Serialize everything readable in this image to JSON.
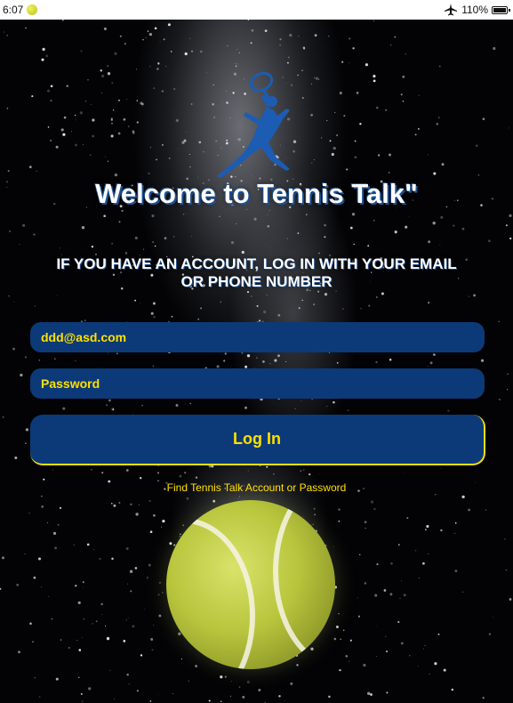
{
  "status_bar": {
    "time": "6:07",
    "battery": "110%"
  },
  "icons": {
    "status_app": "tennis-ball-icon",
    "airplane": "airplane-icon",
    "battery": "battery-icon",
    "logo": "tennis-player-logo"
  },
  "colors": {
    "field_bg": "#0c3a78",
    "accent_text": "#ffe000",
    "title_text": "#ffffff"
  },
  "welcome": {
    "title": "Welcome to Tennis Talk\"",
    "subtitle": "If you have an account, log in with your email or phone number"
  },
  "form": {
    "email_value": "ddd@asd.com",
    "password_placeholder": "Password",
    "login_label": "Log In",
    "find_account_link": "Find Tennis Talk Account or Password"
  }
}
